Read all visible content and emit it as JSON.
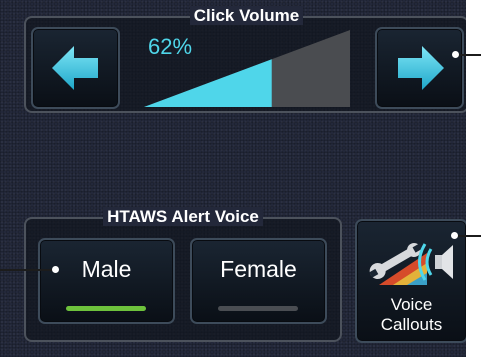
{
  "click_volume": {
    "title": "Click Volume",
    "value_text": "62%",
    "level_fraction": 0.62,
    "decrease_icon": "left-arrow-icon",
    "increase_icon": "right-arrow-icon"
  },
  "htaws_alert_voice": {
    "title": "HTAWS Alert Voice",
    "options": [
      {
        "label": "Male",
        "selected": true
      },
      {
        "label": "Female",
        "selected": false
      }
    ]
  },
  "voice_callouts": {
    "line1": "Voice",
    "line2": "Callouts",
    "icon": "voice-callouts-icon"
  },
  "colors": {
    "accent_cyan": "#4fd6ea",
    "selected_indicator": "#6ec23c",
    "unselected_indicator": "#4a4d52",
    "ramp_inactive": "#4a4c50"
  }
}
